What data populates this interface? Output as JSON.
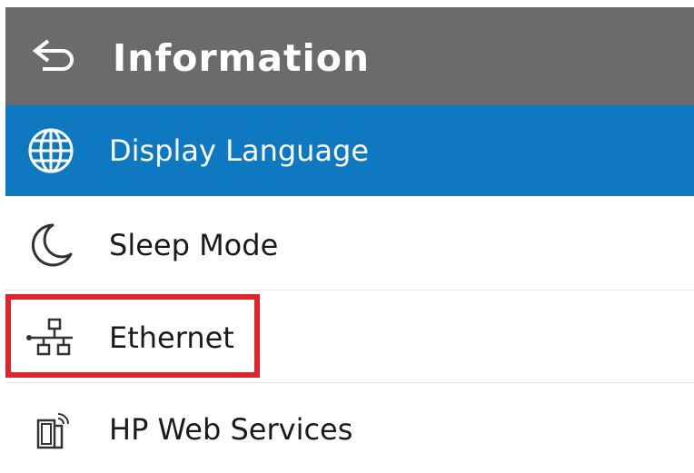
{
  "header": {
    "title": "Information",
    "back_icon": "back-arrow-icon"
  },
  "menu": {
    "items": [
      {
        "label": "Display Language",
        "icon": "globe-icon",
        "selected": true
      },
      {
        "label": "Sleep Mode",
        "icon": "moon-icon",
        "selected": false
      },
      {
        "label": "Ethernet",
        "icon": "network-icon",
        "selected": false
      },
      {
        "label": "HP Web Services",
        "icon": "web-services-icon",
        "selected": false
      }
    ]
  },
  "annotation": {
    "highlight_color": "#e0242d",
    "highlight_target": "Ethernet"
  },
  "colors": {
    "header_bg": "#6b6b6b",
    "selected_bg": "#0e78c1"
  }
}
